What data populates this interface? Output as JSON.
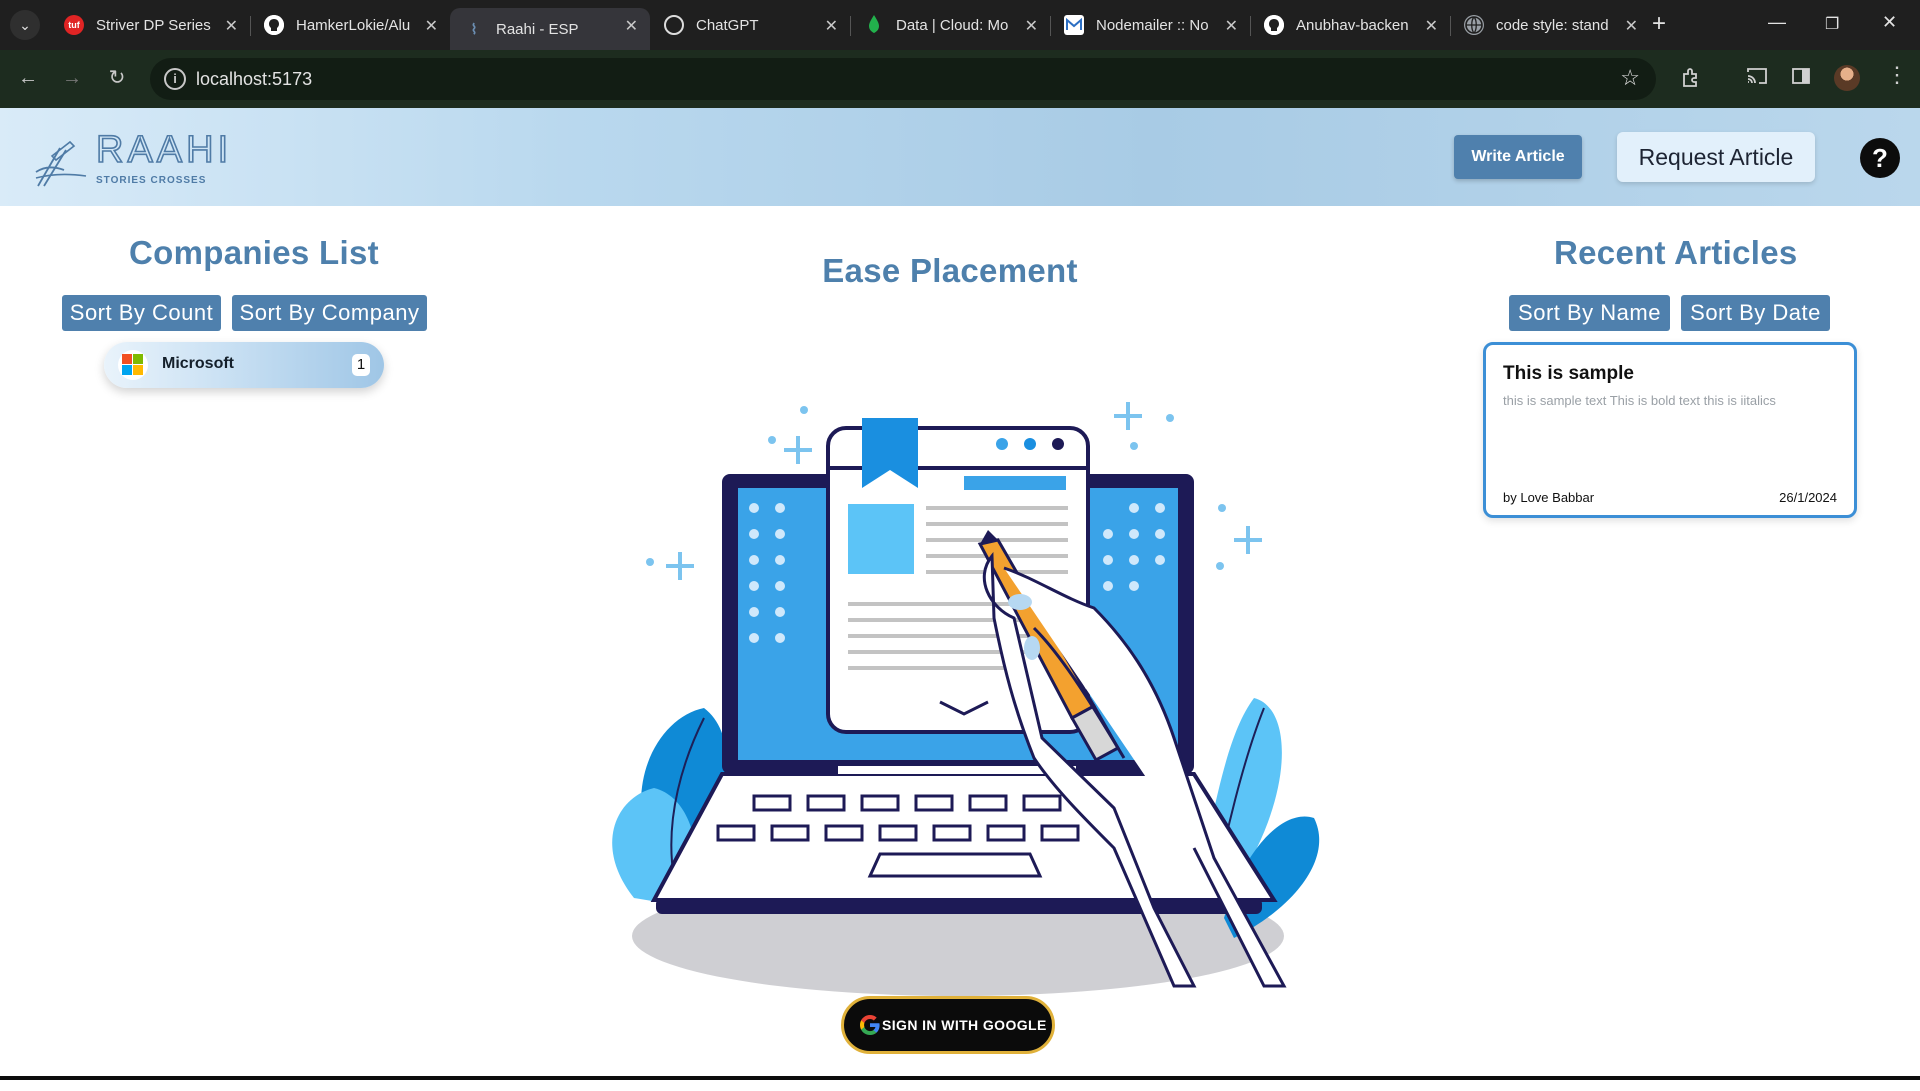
{
  "browser": {
    "tabs": [
      {
        "title": "Striver DP Series",
        "active": false,
        "icon": "tuf-icon",
        "icon_color": "#e02424"
      },
      {
        "title": "HamkerLokie/Alu",
        "active": false,
        "icon": "github-icon",
        "icon_color": "#ffffff"
      },
      {
        "title": "Raahi - ESP",
        "active": true,
        "icon": "raahi-icon",
        "icon_color": "#6c8fb3"
      },
      {
        "title": "ChatGPT",
        "active": false,
        "icon": "chatgpt-icon",
        "icon_color": "#dcdcdc"
      },
      {
        "title": "Data | Cloud: Mo",
        "active": false,
        "icon": "mongodb-icon",
        "icon_color": "#22b14c"
      },
      {
        "title": "Nodemailer :: No",
        "active": false,
        "icon": "nodemailer-icon",
        "icon_color": "#2c6fc3"
      },
      {
        "title": "Anubhav-backen",
        "active": false,
        "icon": "github-icon",
        "icon_color": "#ffffff"
      },
      {
        "title": "code style: stand",
        "active": false,
        "icon": "globe-icon",
        "icon_color": "#9aa0a6"
      }
    ],
    "url": "localhost:5173"
  },
  "header": {
    "logo_text": "RAAHI",
    "logo_tagline": "STORIES CROSSES",
    "write_article_label": "Write Article",
    "request_article_label": "Request Article",
    "help_label": "?"
  },
  "companies": {
    "title": "Companies List",
    "sort_count_label": "Sort By Count",
    "sort_company_label": "Sort By Company",
    "items": [
      {
        "name": "Microsoft",
        "count": "1",
        "logo": "microsoft-logo"
      }
    ]
  },
  "main": {
    "title": "Ease Placement",
    "illustration": "laptop-writing-illustration",
    "signin_label": "SIGN IN WITH GOOGLE"
  },
  "articles": {
    "title": "Recent Articles",
    "sort_name_label": "Sort By Name",
    "sort_date_label": "Sort By Date",
    "items": [
      {
        "title": "This is sample",
        "body": "this is sample text This is bold text this is iitalics",
        "author": "by Love Babbar",
        "date": "26/1/2024"
      }
    ]
  },
  "colors": {
    "accent": "#4f80ad",
    "title": "#4e80ac",
    "card_border": "#3c8fd6",
    "google_border": "#e0b13a"
  }
}
